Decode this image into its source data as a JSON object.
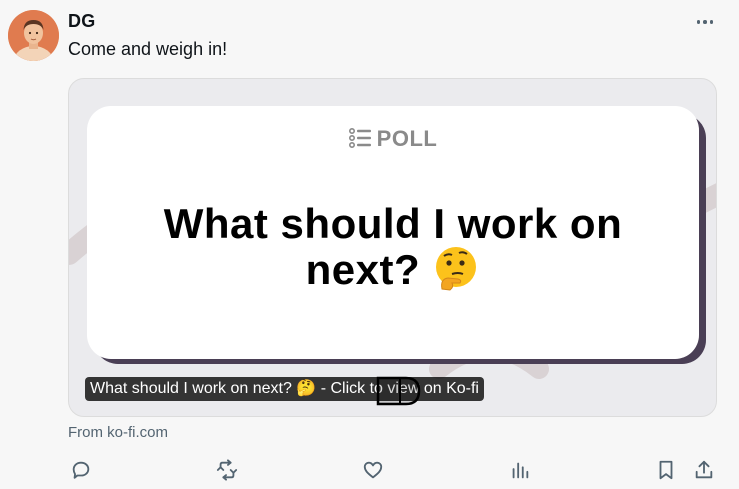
{
  "post": {
    "author": "DG",
    "text": "Come and weigh in!",
    "more_icon": "more-dots-icon"
  },
  "card": {
    "poll_tag": "POLL",
    "question": "What should I work on next?",
    "emoji": "🤔",
    "caption": "What should I work on next? 🤔 - Click to view on Ko-fi",
    "colors": {
      "card_bg": "#ebebee",
      "poll_bg": "#ffffff",
      "poll_shadow": "#4a3f55"
    }
  },
  "source": "From ko-fi.com",
  "actions": [
    {
      "name": "reply-icon"
    },
    {
      "name": "repost-icon"
    },
    {
      "name": "like-icon"
    },
    {
      "name": "views-icon"
    },
    {
      "name": "bookmark-icon"
    },
    {
      "name": "share-icon"
    }
  ]
}
